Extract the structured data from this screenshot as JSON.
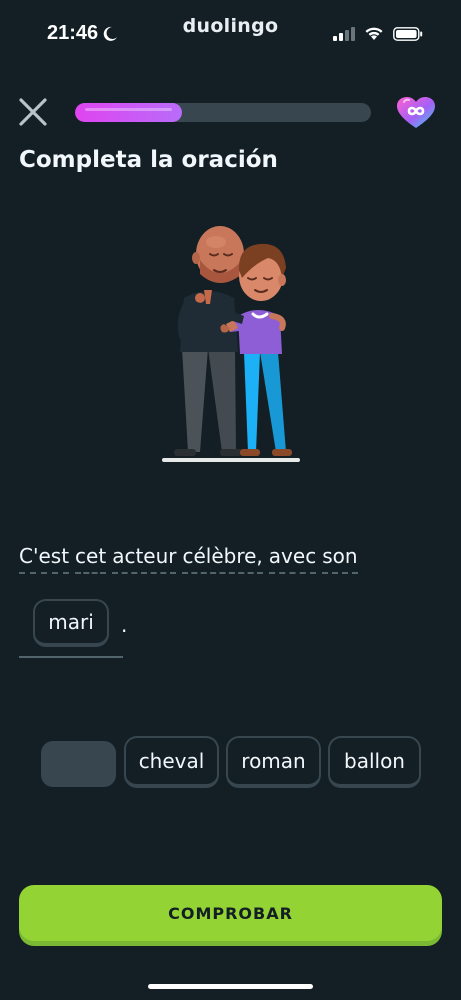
{
  "status_bar": {
    "time": "21:46",
    "app_name": "duolingo"
  },
  "header": {
    "progress_fraction": 0.36,
    "progress_colors": [
      "#e044f0",
      "#b86cf9"
    ],
    "hearts_icon": "infinite-hearts-icon"
  },
  "exercise": {
    "instruction": "Completa la oración",
    "sentence_words": [
      "C'est",
      "cet",
      "acteur",
      "célèbre,",
      "avec",
      "son"
    ],
    "selected_answer": "mari",
    "end_punctuation": "."
  },
  "word_bank": {
    "placeholder_for": "mari",
    "options": [
      "cheval",
      "roman",
      "ballon"
    ]
  },
  "footer": {
    "check_label": "COMPROBAR"
  },
  "colors": {
    "background": "#131f24",
    "accent_green": "#93d333",
    "chip_border": "#37464f"
  }
}
